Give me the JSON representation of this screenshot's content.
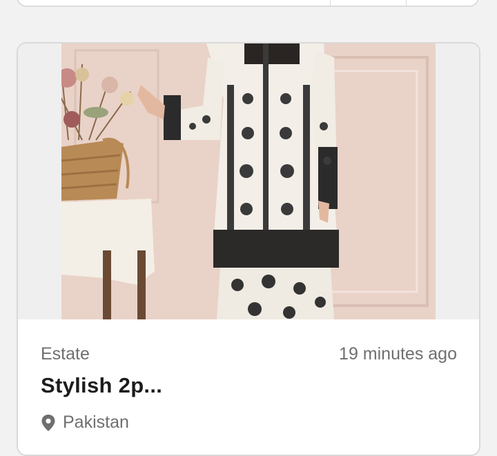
{
  "listing": {
    "category": "Estate",
    "time": "19 minutes ago",
    "title": "Stylish 2p...",
    "location": "Pakistan"
  },
  "icons": {
    "location": "map-pin-icon"
  },
  "colors": {
    "background": "#f2f2f2",
    "card": "#ffffff",
    "border": "#d9d9d9",
    "muted_text": "#6f6f6f",
    "title_text": "#1c1c1c"
  }
}
